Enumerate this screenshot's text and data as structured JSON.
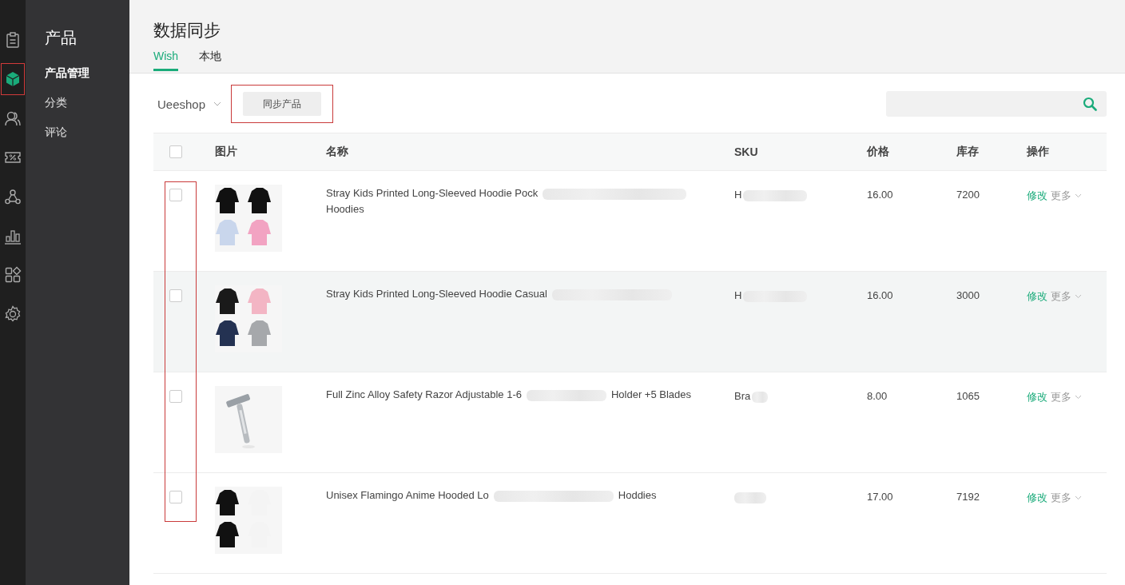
{
  "rail": {
    "items": [
      {
        "selected": false,
        "annotated": false
      },
      {
        "selected": true,
        "annotated": true
      },
      {
        "selected": false,
        "annotated": false
      },
      {
        "selected": false,
        "annotated": false
      },
      {
        "selected": false,
        "annotated": false
      },
      {
        "selected": false,
        "annotated": false
      },
      {
        "selected": false,
        "annotated": false
      },
      {
        "selected": false,
        "annotated": false
      }
    ]
  },
  "sidebar": {
    "title": "产品",
    "items": [
      {
        "label": "产品管理",
        "selected": true
      },
      {
        "label": "分类",
        "selected": false
      },
      {
        "label": "评论",
        "selected": false
      }
    ]
  },
  "header": {
    "title": "数据同步",
    "tabs": [
      {
        "label": "Wish",
        "selected": true
      },
      {
        "label": "本地",
        "selected": false
      }
    ]
  },
  "toolbar": {
    "store": "Ueeshop",
    "sync_button": {
      "label": "同步产品",
      "annotated": true
    }
  },
  "table": {
    "columns": [
      "图片",
      "名称",
      "SKU",
      "价格",
      "库存",
      "操作"
    ],
    "header_checked": false,
    "checkbox_column_annotated": true,
    "rows": [
      {
        "checked": false,
        "hovered": false,
        "name_start": "Stray Kids Printed Long-Sleeved Hoodie Pock",
        "name_line2": "Hoodies",
        "sku_start": "H",
        "price": "16.00",
        "stock": "7200",
        "edit": "修改",
        "more": "更多"
      },
      {
        "checked": false,
        "hovered": true,
        "name_start": "Stray Kids Printed Long-Sleeved Hoodie Casual",
        "sku_start": "H",
        "price": "16.00",
        "stock": "3000",
        "edit": "修改",
        "more": "更多"
      },
      {
        "checked": false,
        "hovered": false,
        "name_start": "Full Zinc Alloy Safety Razor Adjustable 1-6",
        "name_end": "Holder +5 Blades",
        "sku_start": "Bra",
        "price": "8.00",
        "stock": "1065",
        "edit": "修改",
        "more": "更多"
      },
      {
        "checked": false,
        "hovered": false,
        "name_start": "Unisex Flamingo Anime Hooded Lo",
        "name_end": "Hoddies",
        "price": "17.00",
        "stock": "7192",
        "edit": "修改",
        "more": "更多"
      }
    ]
  }
}
